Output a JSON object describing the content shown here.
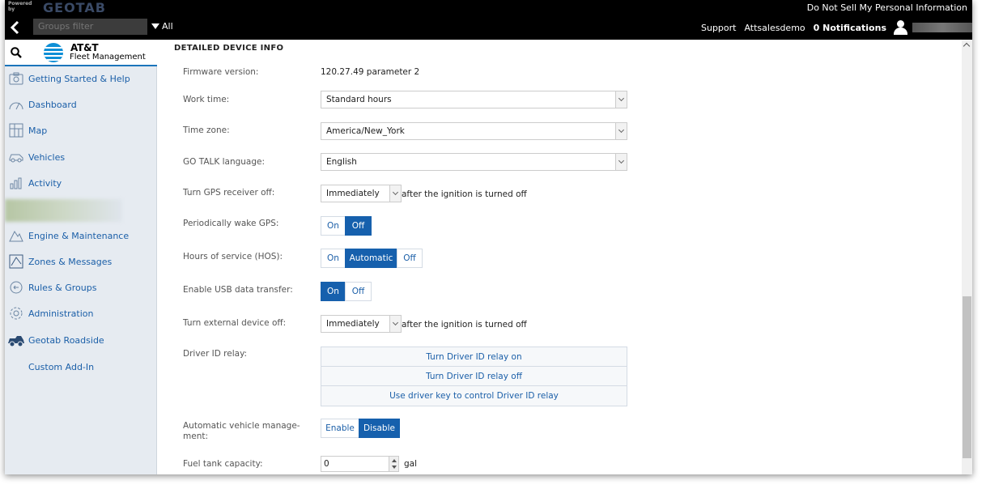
{
  "brand": {
    "powered_by": "Powered by",
    "logo": "GEOTAB"
  },
  "topbar": {
    "privacy_link": "Do Not Sell My Personal Information"
  },
  "navbar": {
    "groups_filter_placeholder": "Groups filter",
    "all_label": "All",
    "support": "Support",
    "account": "Attsalesdemo",
    "notifications": "0 Notifications"
  },
  "sidebar": {
    "logo_line1": "AT&T",
    "logo_line2": "Fleet Management",
    "items": [
      {
        "label": "Getting Started & Help",
        "icon": "help-box-icon"
      },
      {
        "label": "Dashboard",
        "icon": "gauge-icon"
      },
      {
        "label": "Map",
        "icon": "map-icon"
      },
      {
        "label": "Vehicles",
        "icon": "vehicle-icon"
      },
      {
        "label": "Activity",
        "icon": "bar-chart-icon"
      },
      {
        "label": "Engine & Maintenance",
        "icon": "engine-icon"
      },
      {
        "label": "Zones & Messages",
        "icon": "zones-icon"
      },
      {
        "label": "Rules & Groups",
        "icon": "rules-icon"
      },
      {
        "label": "Administration",
        "icon": "gear-icon"
      },
      {
        "label": "Geotab Roadside",
        "icon": "tow-truck-icon"
      },
      {
        "label": "Custom Add-In",
        "icon": ""
      }
    ]
  },
  "main": {
    "section_title": "DETAILED DEVICE INFO",
    "firmware_label": "Firmware version:",
    "firmware_value": "120.27.49 parameter 2",
    "work_time_label": "Work time:",
    "work_time_value": "Standard hours",
    "time_zone_label": "Time zone:",
    "time_zone_value": "America/New_York",
    "go_talk_label": "GO TALK language:",
    "go_talk_value": "English",
    "gps_off_label": "Turn GPS receiver off:",
    "gps_off_value": "Immediately",
    "gps_off_suffix": "after the ignition is turned off",
    "wake_gps_label": "Periodically wake GPS:",
    "wake_gps": {
      "on": "On",
      "off": "Off",
      "selected": "Off"
    },
    "hos_label": "Hours of service (HOS):",
    "hos": {
      "on": "On",
      "automatic": "Automatic",
      "off": "Off",
      "selected": "Automatic"
    },
    "usb_label": "Enable USB data transfer:",
    "usb": {
      "on": "On",
      "off": "Off",
      "selected": "On"
    },
    "ext_off_label": "Turn external device off:",
    "ext_off_value": "Immediately",
    "ext_off_suffix": "after the ignition is turned off",
    "relay_label": "Driver ID relay:",
    "relay_buttons": [
      "Turn Driver ID relay on",
      "Turn Driver ID relay off",
      "Use driver key to control Driver ID relay"
    ],
    "avm_label_1": "Automatic vehicle manage-",
    "avm_label_2": "ment:",
    "avm": {
      "enable": "Enable",
      "disable": "Disable",
      "selected": "Disable"
    },
    "fuel_label": "Fuel tank capacity:",
    "fuel_value": "0",
    "fuel_unit": "gal"
  },
  "colors": {
    "accent": "#1660ad",
    "link": "#1b5fa8",
    "sidebar_bg": "#e6ebf1",
    "topbar_bg": "#000000"
  }
}
